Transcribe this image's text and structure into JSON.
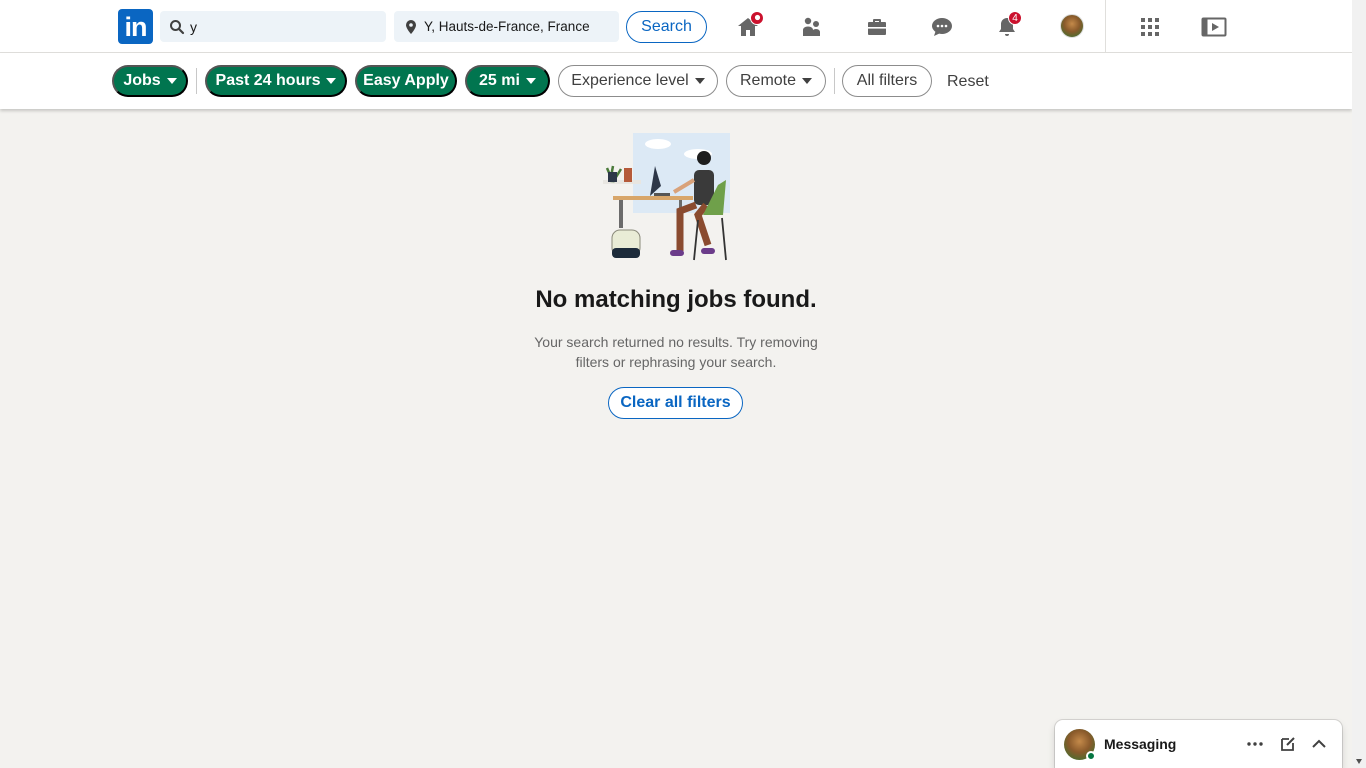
{
  "nav": {
    "logo_text": "in",
    "keyword_value": "y",
    "location_value": "Y, Hauts-de-France, France",
    "search_label": "Search",
    "notifications_count": "4"
  },
  "filters": {
    "jobs": "Jobs",
    "date_posted": "Past 24 hours",
    "easy_apply": "Easy Apply",
    "distance": "25 mi",
    "experience": "Experience level",
    "remote": "Remote",
    "all_filters": "All filters",
    "reset": "Reset"
  },
  "empty_state": {
    "title": "No matching jobs found.",
    "description": "Your search returned no results. Try removing filters or rephrasing your search.",
    "clear_button": "Clear all filters"
  },
  "messaging": {
    "title": "Messaging"
  },
  "colors": {
    "brand": "#0a66c2",
    "active_filter": "#01754f",
    "badge": "#cb112d",
    "background": "#f3f2ef"
  },
  "icons": [
    "search-icon",
    "location-pin-icon",
    "home-icon",
    "my-network-icon",
    "jobs-icon",
    "messaging-icon",
    "notifications-icon",
    "me-avatar",
    "work-grid-icon",
    "learning-icon",
    "more-icon",
    "compose-icon",
    "chevron-up-icon"
  ]
}
